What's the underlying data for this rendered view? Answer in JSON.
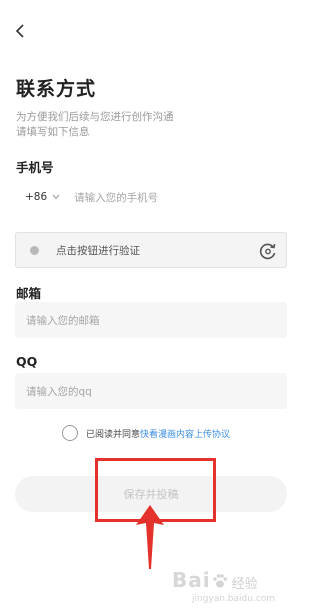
{
  "header": {
    "back_icon": "chevron-left-icon"
  },
  "page": {
    "title": "联系方式",
    "description_line1": "为方便我们后续与您进行创作沟通",
    "description_line2": "请填写如下信息"
  },
  "phone": {
    "label": "手机号",
    "country_code": "+86",
    "placeholder": "请输入您的手机号"
  },
  "verify": {
    "text": "点击按钮进行验证",
    "icon": "refresh-icon"
  },
  "email": {
    "label": "邮箱",
    "placeholder": "请输入您的邮箱"
  },
  "qq": {
    "label": "QQ",
    "placeholder": "请输入您的qq"
  },
  "agreement": {
    "checked": false,
    "text": "已阅读并同意",
    "link": "快看漫画内容上传协议"
  },
  "submit": {
    "label": "保存并投稿"
  },
  "annotation": {
    "color": "#e4312b"
  },
  "watermark": {
    "main": "Bai",
    "cn": "经验",
    "sub": "jingyan.baidu.com"
  },
  "colors": {
    "link": "#3a8ee6",
    "accent": "#e4312b"
  }
}
